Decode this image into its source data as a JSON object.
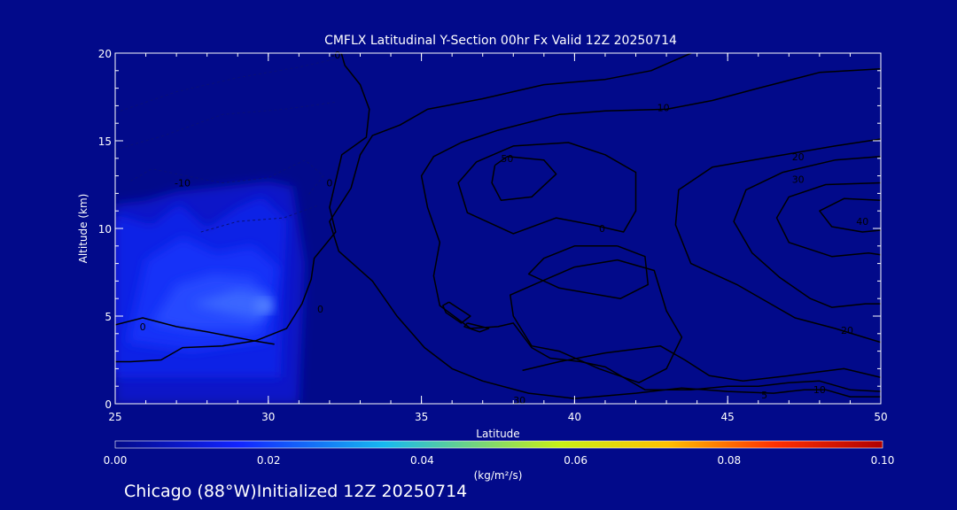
{
  "chart_data": {
    "type": "contour",
    "title": "CMFLX Latitudinal Y-Section 00hr  Fx Valid 12Z 20250714",
    "xlabel": "Latitude",
    "ylabel": "Altitude (km)",
    "xlim": [
      25,
      50
    ],
    "ylim": [
      0,
      20
    ],
    "x_ticks": [
      "25",
      "30",
      "35",
      "40",
      "45",
      "50"
    ],
    "y_ticks": [
      "0",
      "5",
      "10",
      "15",
      "20"
    ],
    "contour_labels": [
      {
        "text": "-0",
        "x": 32.2,
        "y": 19.9
      },
      {
        "text": "-10",
        "x": 27.2,
        "y": 12.6
      },
      {
        "text": "0",
        "x": 31.7,
        "y": 5.4
      },
      {
        "text": "0",
        "x": 25.9,
        "y": 4.4
      },
      {
        "text": "0",
        "x": 32.0,
        "y": 12.6
      },
      {
        "text": "10",
        "x": 42.9,
        "y": 16.9
      },
      {
        "text": "10",
        "x": 48.0,
        "y": 0.8
      },
      {
        "text": "5",
        "x": 46.2,
        "y": 0.5
      },
      {
        "text": "20",
        "x": 47.3,
        "y": 14.1
      },
      {
        "text": "30",
        "x": 47.3,
        "y": 12.8
      },
      {
        "text": "40",
        "x": 49.4,
        "y": 10.4
      },
      {
        "text": "20",
        "x": 48.9,
        "y": 4.2
      },
      {
        "text": "50",
        "x": 37.8,
        "y": 14.0
      },
      {
        "text": "0",
        "x": 40.9,
        "y": 10.0
      },
      {
        "text": "30",
        "x": 38.2,
        "y": 0.2
      }
    ],
    "shading": {
      "region_lat": [
        25,
        31
      ],
      "region_alt": [
        0,
        12.7
      ],
      "max_value": 0.02,
      "max_at": {
        "lat": 29.8,
        "alt": 5.6
      }
    },
    "colorbar": {
      "ticks": [
        "0.00",
        "0.02",
        "0.04",
        "0.06",
        "0.08",
        "0.10"
      ],
      "units": "(kg/m²/s)",
      "colors": [
        "#020a8a",
        "#1224ff",
        "#16b8f0",
        "#c8f014",
        "#ffc000",
        "#ff3000",
        "#b00000"
      ]
    },
    "grid": false
  },
  "footer": {
    "caption": "Chicago (88°W)Initialized 12Z 20250714"
  }
}
